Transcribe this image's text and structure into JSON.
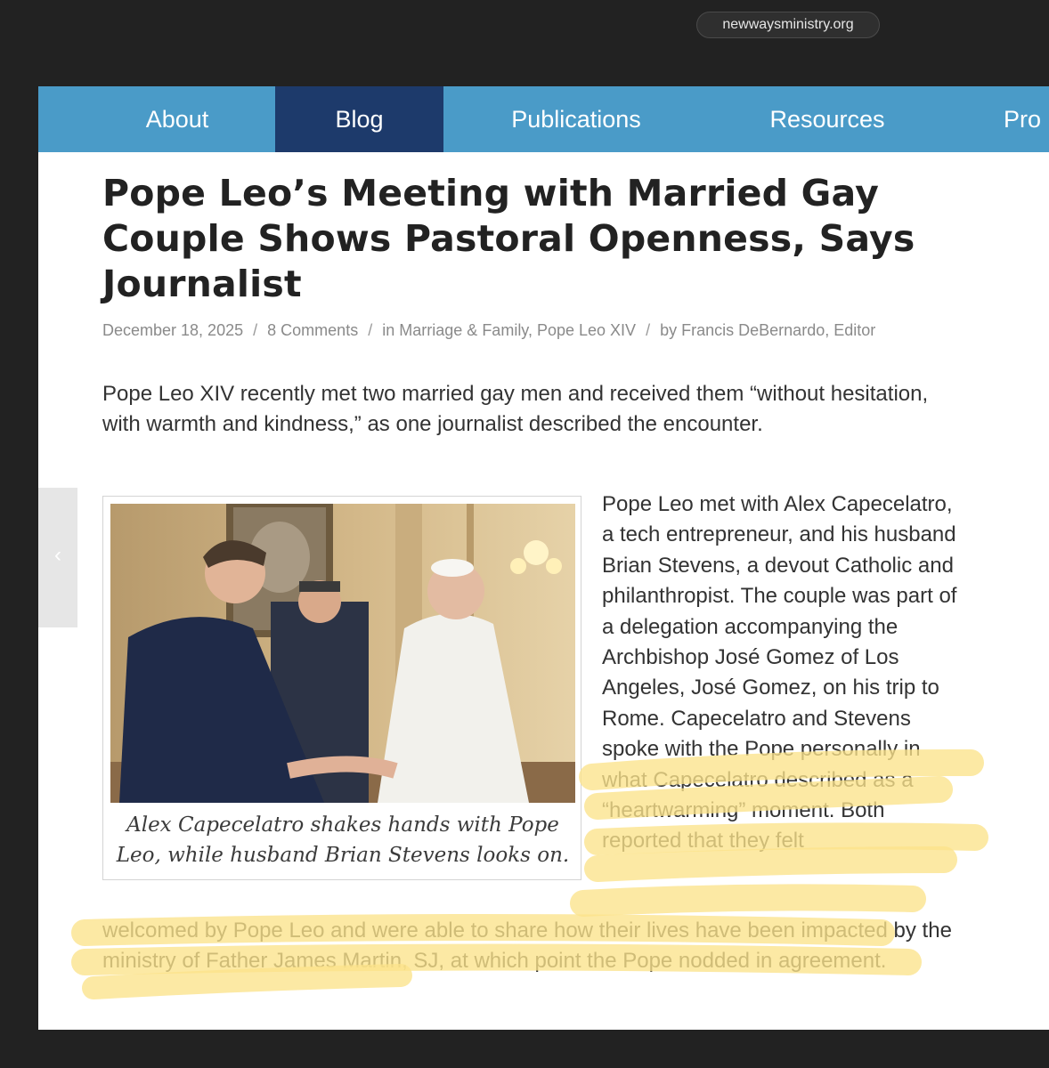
{
  "browser": {
    "domain": "newwaysministry.org"
  },
  "nav": {
    "items": [
      {
        "label": "About"
      },
      {
        "label": "Blog",
        "active": true
      },
      {
        "label": "Publications"
      },
      {
        "label": "Resources"
      },
      {
        "label": "Pro"
      }
    ],
    "bar_color": "#4a9bc8",
    "active_color": "#1d3a6b"
  },
  "article": {
    "title": "Pope Leo’s Meeting with Married Gay Couple Shows Pastoral Openness, Says Journalist",
    "meta": {
      "date": "December 18, 2025",
      "comments": "8 Comments",
      "in_prefix": "in",
      "categories": "Marriage & Family, Pope Leo XIV",
      "by_prefix": "by",
      "author": "Francis DeBernardo, Editor"
    },
    "lead": "Pope Leo XIV recently met two married gay men and received them “without hesitation, with warmth and kindness,” as one journalist described the encounter.",
    "figure": {
      "caption": "Alex Capecelatro shakes hands with Pope Leo, while husband Brian Stevens looks on."
    },
    "side_text": "Pope Leo met with Alex Capecelatro, a tech entrepreneur, and his husband Brian Stevens, a devout Catholic and philanthropist. The couple was part of a delegation accompanying the Archbishop José Gomez of Los Angeles, José Gomez, on his trip to Rome. Capecelatro and Stevens spoke with the Pope personally in what Capecelatro described as a “heartwarming” moment. Both reported that they felt",
    "bottom_text": "welcomed by Pope Leo and were able to share how their lives have been impacted by the ministry of Father James Martin, SJ, at which point the Pope nodded in agreement."
  },
  "highlight_color": "#fbe38a"
}
